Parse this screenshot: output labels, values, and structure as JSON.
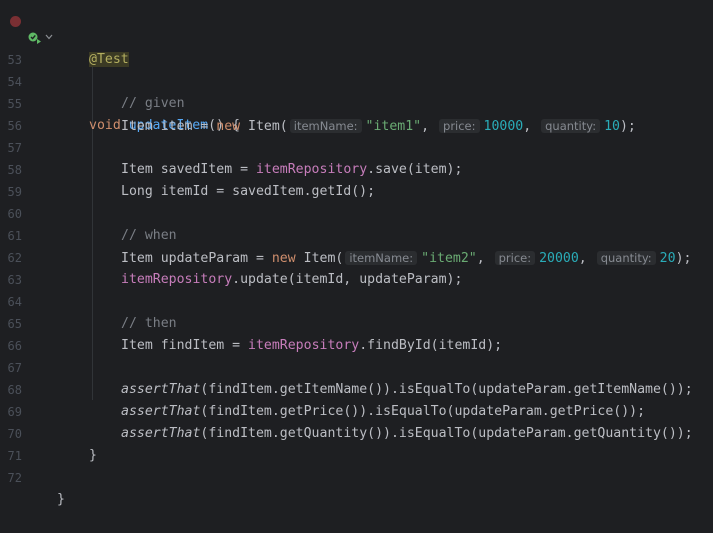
{
  "lines": [
    {
      "num": "",
      "annotation": "@Test"
    },
    {
      "num": "53",
      "tokens": [
        "void",
        "updateItem",
        "() {"
      ]
    },
    {
      "num": "54",
      "comment": "// given"
    },
    {
      "num": "55",
      "tokens": [
        "Item item = ",
        "new",
        " Item(",
        "itemName:",
        "\"item1\"",
        ", ",
        "price:",
        "10000",
        ", ",
        "quantity:",
        "10",
        ");"
      ]
    },
    {
      "num": "56"
    },
    {
      "num": "57",
      "tokens": [
        "Item savedItem = ",
        "itemRepository",
        ".save(item);"
      ]
    },
    {
      "num": "58",
      "tokens": [
        "Long itemId = savedItem.getId();"
      ]
    },
    {
      "num": "59"
    },
    {
      "num": "60",
      "comment": "// when"
    },
    {
      "num": "61",
      "tokens": [
        "Item updateParam = ",
        "new",
        " Item(",
        "itemName:",
        "\"item2\"",
        ", ",
        "price:",
        "20000",
        ", ",
        "quantity:",
        "20",
        ");"
      ]
    },
    {
      "num": "62",
      "tokens": [
        "itemRepository",
        ".update(itemId, updateParam);"
      ]
    },
    {
      "num": "63"
    },
    {
      "num": "64",
      "comment": "// then"
    },
    {
      "num": "65",
      "tokens": [
        "Item findItem = ",
        "itemRepository",
        ".findById(itemId);"
      ]
    },
    {
      "num": "66"
    },
    {
      "num": "67",
      "tokens": [
        "assertThat",
        "(findItem.getItemName()).isEqualTo(updateParam.getItemName());"
      ]
    },
    {
      "num": "68",
      "tokens": [
        "assertThat",
        "(findItem.getPrice()).isEqualTo(updateParam.getPrice());"
      ]
    },
    {
      "num": "69",
      "tokens": [
        "assertThat",
        "(findItem.getQuantity()).isEqualTo(updateParam.getQuantity());"
      ]
    },
    {
      "num": "70",
      "tokens": [
        "}"
      ]
    },
    {
      "num": "71"
    },
    {
      "num": "72",
      "tokens": [
        "}"
      ]
    }
  ],
  "icons": {
    "breakpoint": "breakpoint-icon",
    "run": "run-test-icon",
    "fold": "fold-chevron-icon"
  },
  "colors": {
    "background": "#1e1f22",
    "keyword": "#cf8e6d",
    "method": "#56a8f5",
    "comment": "#7a7e85",
    "string": "#6aab73",
    "number": "#2aacb8",
    "field": "#c77dbb",
    "annotation": "#b3ae60"
  }
}
